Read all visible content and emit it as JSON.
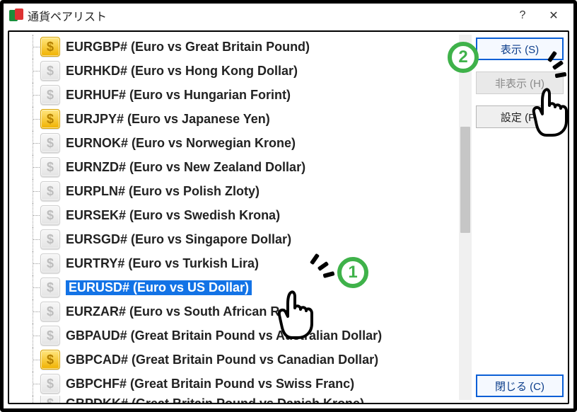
{
  "window": {
    "title": "通貨ペアリスト",
    "help": "?",
    "close": "✕"
  },
  "buttons": {
    "show": "表示 (S)",
    "hide": "非表示 (H)",
    "props": "設定 (P)",
    "close": "閉じる (C)"
  },
  "annotations": {
    "step1": "1",
    "step2": "2"
  },
  "pairs": [
    {
      "sym": "EURGBP#",
      "desc": "(Euro vs Great Britain Pound)",
      "active": true
    },
    {
      "sym": "EURHKD#",
      "desc": "(Euro vs Hong Kong Dollar)",
      "active": false
    },
    {
      "sym": "EURHUF#",
      "desc": "(Euro vs Hungarian Forint)",
      "active": false
    },
    {
      "sym": "EURJPY#",
      "desc": "(Euro vs Japanese Yen)",
      "active": true
    },
    {
      "sym": "EURNOK#",
      "desc": "(Euro vs Norwegian Krone)",
      "active": false
    },
    {
      "sym": "EURNZD#",
      "desc": "(Euro vs New Zealand Dollar)",
      "active": false
    },
    {
      "sym": "EURPLN#",
      "desc": "(Euro vs Polish Zloty)",
      "active": false
    },
    {
      "sym": "EURSEK#",
      "desc": "(Euro vs Swedish Krona)",
      "active": false
    },
    {
      "sym": "EURSGD#",
      "desc": "(Euro vs Singapore Dollar)",
      "active": false
    },
    {
      "sym": "EURTRY#",
      "desc": "(Euro vs Turkish Lira)",
      "active": false
    },
    {
      "sym": "EURUSD#",
      "desc": "(Euro vs US Dollar)",
      "active": false,
      "selected": true
    },
    {
      "sym": "EURZAR#",
      "desc": "(Euro vs South African Rand)",
      "active": false
    },
    {
      "sym": "GBPAUD#",
      "desc": "(Great Britain Pound vs Australian Dollar)",
      "active": false
    },
    {
      "sym": "GBPCAD#",
      "desc": "(Great Britain Pound vs Canadian Dollar)",
      "active": true
    },
    {
      "sym": "GBPCHF#",
      "desc": "(Great Britain Pound vs Swiss Franc)",
      "active": false
    },
    {
      "sym": "GBPDKK#",
      "desc": "(Great Britain Pound vs Danish Krone)",
      "active": false
    }
  ]
}
